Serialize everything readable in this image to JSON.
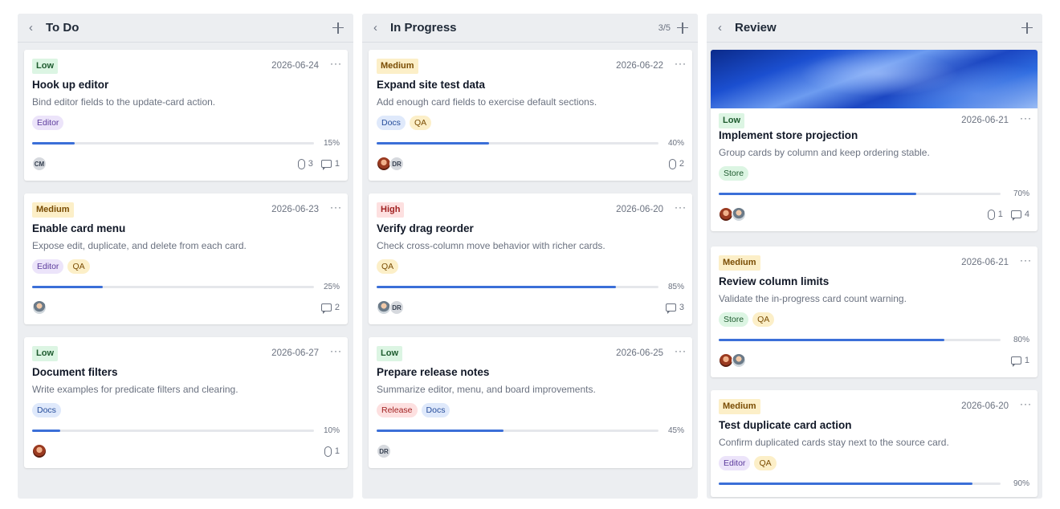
{
  "columns": [
    {
      "title": "To Do",
      "count": "",
      "cards": [
        {
          "priority": "Low",
          "priority_class": "low",
          "date": "2026-06-24",
          "title": "Hook up editor",
          "description": "Bind editor fields to the update-card action.",
          "tags": [
            {
              "label": "Editor",
              "kind": "editor"
            }
          ],
          "progress": 15,
          "progress_label": "15%",
          "avatars": [
            {
              "initials": "CM",
              "style": "initials"
            }
          ],
          "attachments": "3",
          "comments": "1"
        },
        {
          "priority": "Medium",
          "priority_class": "medium",
          "date": "2026-06-23",
          "title": "Enable card menu",
          "description": "Expose edit, duplicate, and delete from each card.",
          "tags": [
            {
              "label": "Editor",
              "kind": "editor"
            },
            {
              "label": "QA",
              "kind": "qa"
            }
          ],
          "progress": 25,
          "progress_label": "25%",
          "avatars": [
            {
              "initials": "",
              "style": "photo-b"
            }
          ],
          "attachments": "",
          "comments": "2"
        },
        {
          "priority": "Low",
          "priority_class": "low",
          "date": "2026-06-27",
          "title": "Document filters",
          "description": "Write examples for predicate filters and clearing.",
          "tags": [
            {
              "label": "Docs",
              "kind": "docs"
            }
          ],
          "progress": 10,
          "progress_label": "10%",
          "avatars": [
            {
              "initials": "",
              "style": "photo-a"
            }
          ],
          "attachments": "1",
          "comments": ""
        }
      ]
    },
    {
      "title": "In Progress",
      "count": "3/5",
      "cards": [
        {
          "priority": "Medium",
          "priority_class": "medium",
          "date": "2026-06-22",
          "title": "Expand site test data",
          "description": "Add enough card fields to exercise default sections.",
          "tags": [
            {
              "label": "Docs",
              "kind": "docs"
            },
            {
              "label": "QA",
              "kind": "qa"
            }
          ],
          "progress": 40,
          "progress_label": "40%",
          "avatars": [
            {
              "initials": "",
              "style": "photo-a"
            },
            {
              "initials": "DR",
              "style": "initials"
            }
          ],
          "attachments": "2",
          "comments": ""
        },
        {
          "priority": "High",
          "priority_class": "high",
          "date": "2026-06-20",
          "title": "Verify drag reorder",
          "description": "Check cross-column move behavior with richer cards.",
          "tags": [
            {
              "label": "QA",
              "kind": "qa"
            }
          ],
          "progress": 85,
          "progress_label": "85%",
          "avatars": [
            {
              "initials": "",
              "style": "photo-b"
            },
            {
              "initials": "DR",
              "style": "initials"
            }
          ],
          "attachments": "",
          "comments": "3"
        },
        {
          "priority": "Low",
          "priority_class": "low",
          "date": "2026-06-25",
          "title": "Prepare release notes",
          "description": "Summarize editor, menu, and board improvements.",
          "tags": [
            {
              "label": "Release",
              "kind": "release"
            },
            {
              "label": "Docs",
              "kind": "docs"
            }
          ],
          "progress": 45,
          "progress_label": "45%",
          "avatars": [
            {
              "initials": "DR",
              "style": "initials"
            }
          ],
          "attachments": "",
          "comments": ""
        }
      ]
    },
    {
      "title": "Review",
      "count": "",
      "cards": [
        {
          "priority": "Low",
          "priority_class": "low",
          "date": "2026-06-21",
          "title": "Implement store projection",
          "description": "Group cards by column and keep ordering stable.",
          "tags": [
            {
              "label": "Store",
              "kind": "store"
            }
          ],
          "progress": 70,
          "progress_label": "70%",
          "avatars": [
            {
              "initials": "",
              "style": "photo-a"
            },
            {
              "initials": "",
              "style": "photo-b"
            }
          ],
          "attachments": "1",
          "comments": "4",
          "cover": true
        },
        {
          "priority": "Medium",
          "priority_class": "medium",
          "date": "2026-06-21",
          "title": "Review column limits",
          "description": "Validate the in-progress card count warning.",
          "tags": [
            {
              "label": "Store",
              "kind": "store"
            },
            {
              "label": "QA",
              "kind": "qa"
            }
          ],
          "progress": 80,
          "progress_label": "80%",
          "avatars": [
            {
              "initials": "",
              "style": "photo-a"
            },
            {
              "initials": "",
              "style": "photo-b"
            }
          ],
          "attachments": "",
          "comments": "1"
        },
        {
          "priority": "Medium",
          "priority_class": "medium",
          "date": "2026-06-20",
          "title": "Test duplicate card action",
          "description": "Confirm duplicated cards stay next to the source card.",
          "tags": [
            {
              "label": "Editor",
              "kind": "editor"
            },
            {
              "label": "QA",
              "kind": "qa"
            }
          ],
          "progress": 90,
          "progress_label": "90%",
          "avatars": [],
          "attachments": "",
          "comments": ""
        }
      ]
    }
  ]
}
